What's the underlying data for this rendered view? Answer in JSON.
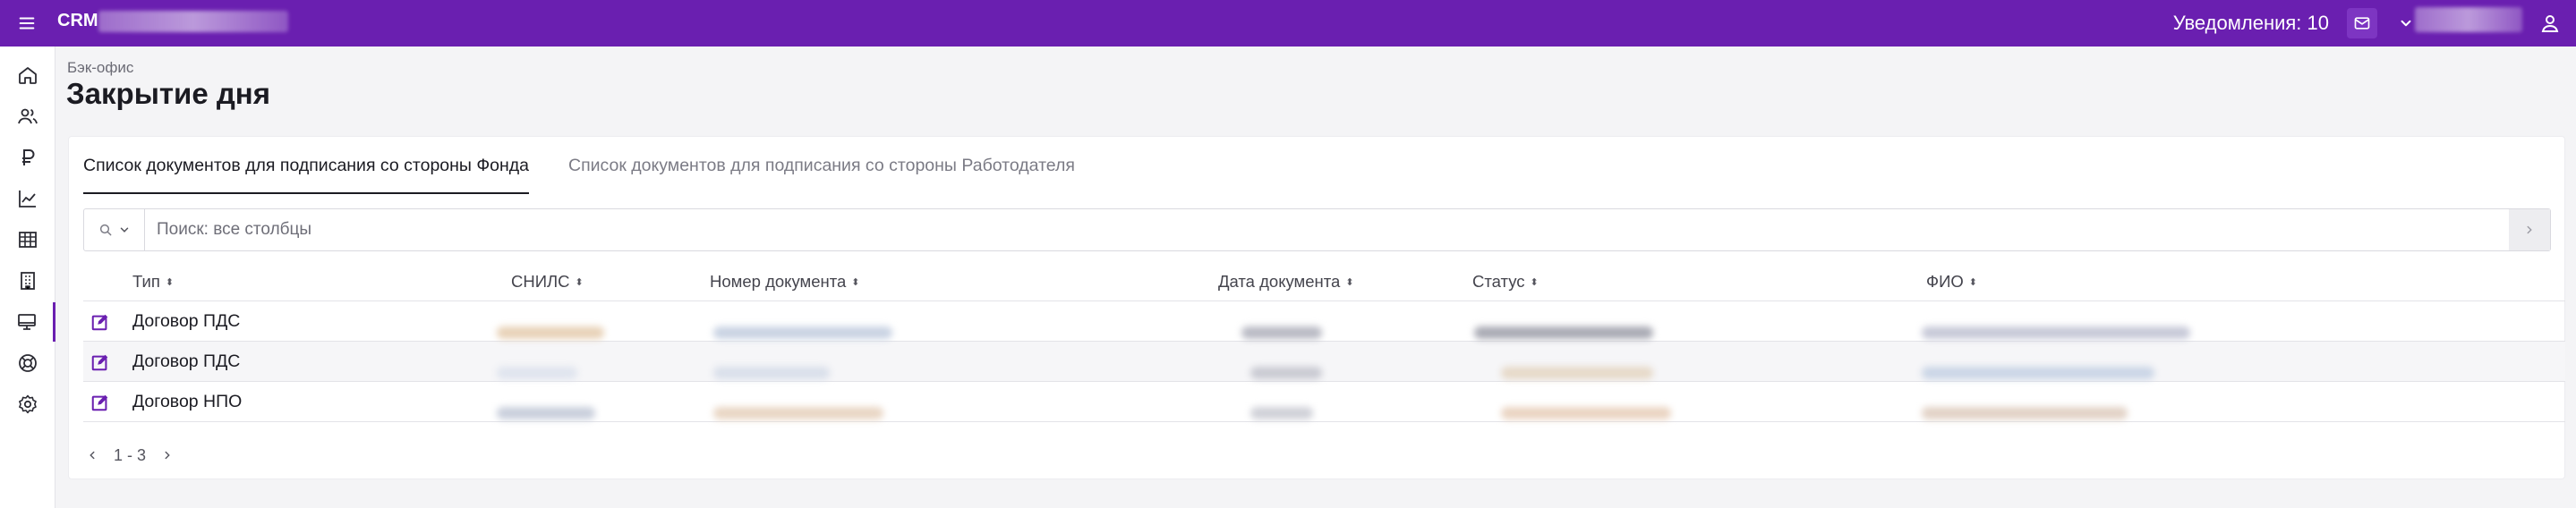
{
  "topbar": {
    "app_title": "CRM",
    "notifications_label": "Уведомления: 10",
    "icons": [
      "menu-icon",
      "mail-icon",
      "chevron-down-icon",
      "user-icon"
    ],
    "background": "#6a1fb0"
  },
  "sidebar": {
    "items": [
      {
        "icon": "home-icon"
      },
      {
        "icon": "users-icon"
      },
      {
        "icon": "ruble-icon"
      },
      {
        "icon": "chart-line-icon"
      },
      {
        "icon": "table-icon"
      },
      {
        "icon": "building-icon"
      },
      {
        "icon": "monitor-icon",
        "active": true
      },
      {
        "icon": "lifebuoy-icon"
      },
      {
        "icon": "gear-icon"
      }
    ]
  },
  "header": {
    "breadcrumb": "Бэк-офис",
    "title": "Закрытие дня"
  },
  "tabs": [
    {
      "label": "Список документов для подписания со стороны Фонда",
      "active": true
    },
    {
      "label": "Список документов для подписания со стороны Работодателя",
      "active": false
    }
  ],
  "search": {
    "placeholder": "Поиск: все столбцы",
    "value": ""
  },
  "table": {
    "columns": [
      "Тип",
      "СНИЛС",
      "Номер документа",
      "Дата документа",
      "Статус",
      "ФИО"
    ],
    "rows": [
      {
        "type": "Договор ПДС"
      },
      {
        "type": "Договор ПДС"
      },
      {
        "type": "Договор НПО"
      }
    ]
  },
  "pagination": {
    "range": "1 - 3"
  }
}
